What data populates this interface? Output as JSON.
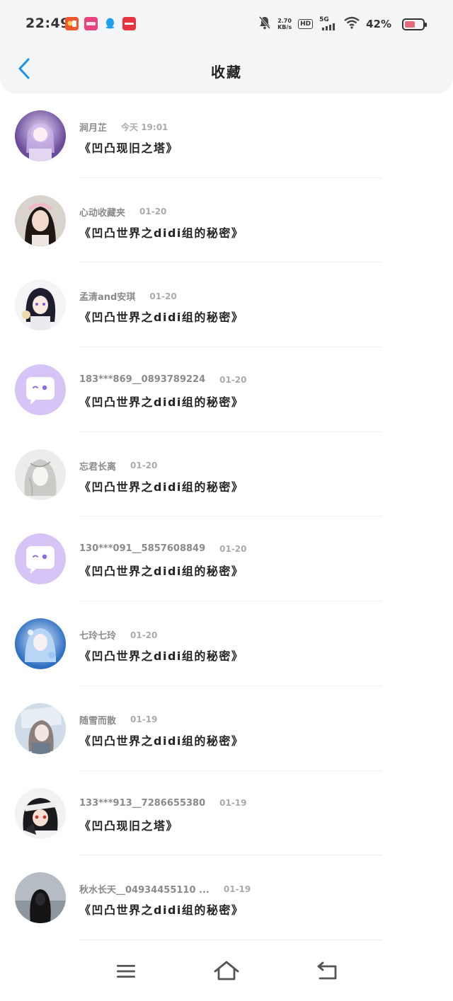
{
  "status_bar": {
    "time": "22:49",
    "apps": [
      {
        "icon": "app-icon-red-orange",
        "label": "",
        "color": "#f0572c"
      },
      {
        "icon": "app-icon-pink",
        "label": "",
        "color": "#e8437a"
      },
      {
        "icon": "qq-icon",
        "label": "",
        "color": "#1ea0f0"
      },
      {
        "icon": "app-icon-red",
        "label": "",
        "color": "#e8323d"
      }
    ],
    "speed_value": "2.70",
    "speed_unit": "KB/s",
    "hd": "HD",
    "network": "5G",
    "battery_percent": "42%"
  },
  "header": {
    "title": "收藏",
    "back_icon": "chevron-left-icon",
    "accent": "#1a93e6"
  },
  "favorites": [
    {
      "user": "涧月芷",
      "date": "今天 19:01",
      "book": "《凹凸现旧之塔》",
      "avatar": "anime-purple"
    },
    {
      "user": "心动收藏夹",
      "date": "01-20",
      "book": "《凹凸世界之didi组的秘密》",
      "avatar": "photo-girl"
    },
    {
      "user": "孟清and安琪",
      "date": "01-20",
      "book": "《凹凸世界之didi组的秘密》",
      "avatar": "anime-dark-hair"
    },
    {
      "user": "183***869__0893789224",
      "date": "01-20",
      "book": "《凹凸世界之didi组的秘密》",
      "avatar": "default-chat"
    },
    {
      "user": "忘君长离",
      "date": "01-20",
      "book": "《凹凸世界之didi组的秘密》",
      "avatar": "sketch-grey"
    },
    {
      "user": "130***091__5857608849",
      "date": "01-20",
      "book": "《凹凸世界之didi组的秘密》",
      "avatar": "default-chat"
    },
    {
      "user": "七玲七玲",
      "date": "01-20",
      "book": "《凹凸世界之didi组的秘密》",
      "avatar": "anime-blue"
    },
    {
      "user": "随雪而散",
      "date": "01-19",
      "book": "《凹凸世界之didi组的秘密》",
      "avatar": "anime-pale-blue"
    },
    {
      "user": "133***913__7286655380",
      "date": "01-19",
      "book": "《凹凸现旧之塔》",
      "avatar": "anime-bandana"
    },
    {
      "user": "秋水长天__04934455110 ...",
      "date": "01-19",
      "book": "《凹凸世界之didi组的秘密》",
      "avatar": "photo-dark-hair"
    }
  ],
  "nav": {
    "menu_icon": "menu-icon",
    "home_icon": "home-icon",
    "back_icon": "back-icon"
  },
  "colors": {
    "background": "#ffffff",
    "header_bg": "#f4f5f7",
    "default_avatar": "#d7c4f6",
    "username": "#8a8a8a",
    "date": "#aaaaaa"
  }
}
